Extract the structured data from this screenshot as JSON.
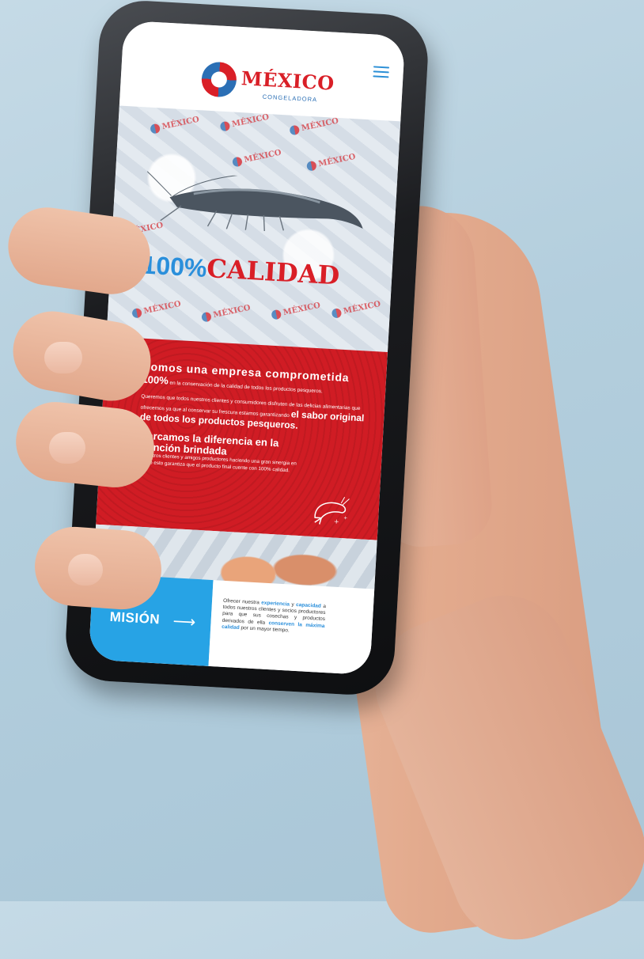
{
  "header": {
    "logo_title": "MÉXICO",
    "logo_subtitle": "CONGELADORA",
    "menu_icon": "hamburger-menu-icon"
  },
  "hero": {
    "watermark": "MÉXICO",
    "title_number": "100%",
    "title_word": "CALIDAD"
  },
  "intro": {
    "headline": "Somos una empresa comprometida",
    "percent": "100%",
    "headline_tail": " en la conservación de la calidad de todos los productos pesqueros.",
    "paragraph_start": "Queremos que todos nuestros clientes y consumidores disfruten de las delicias alimentarias que ofrecemos ya que al conservar su frescura estamos garantizando ",
    "paragraph_bold": "el sabor original de todos los productos pesqueros.",
    "difference_head": "Marcamos la diferencia en la atención brindada",
    "difference_body": " a nuestros clientes y amigos productores haciendo una gran sinergia en equipo esto garantiza que el producto final cuente con 100% calidad.",
    "icon": "shrimp-icon"
  },
  "mission": {
    "label": "MISIÓN",
    "arrow": "⟶",
    "text_1": "Ofrecer nuestra ",
    "hl_1": "experiencia",
    "text_2": " y ",
    "hl_2": "capacidad",
    "text_3": " a todos nuestros clientes y socios productores para que sus cosechas y productos derivados de ella ",
    "hl_3": "conserven la máxima calidad",
    "text_4": " por un mayor tiempo."
  },
  "colors": {
    "brand_red": "#d91f27",
    "brand_blue": "#2a8fdb",
    "mission_blue": "#27a3e5"
  }
}
